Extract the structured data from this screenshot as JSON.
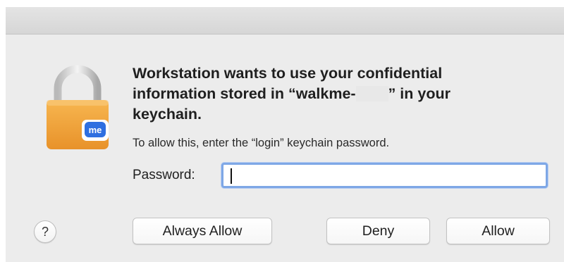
{
  "dialog": {
    "title_line1": "Workstation wants to use your confidential",
    "title_line2a": "information stored in “walkme-",
    "title_line2b": "” in your",
    "title_line3": "keychain.",
    "subtitle": "To allow this, enter the “login” keychain password.",
    "password_label": "Password:",
    "password_value": "",
    "badge_text": "me",
    "icon": "lock-icon"
  },
  "buttons": {
    "always_allow": "Always Allow",
    "deny": "Deny",
    "allow": "Allow",
    "help": "?"
  },
  "colors": {
    "lock_body": "#f2a43a",
    "badge": "#2f6fe0",
    "focus_ring": "#7ea7e6"
  }
}
